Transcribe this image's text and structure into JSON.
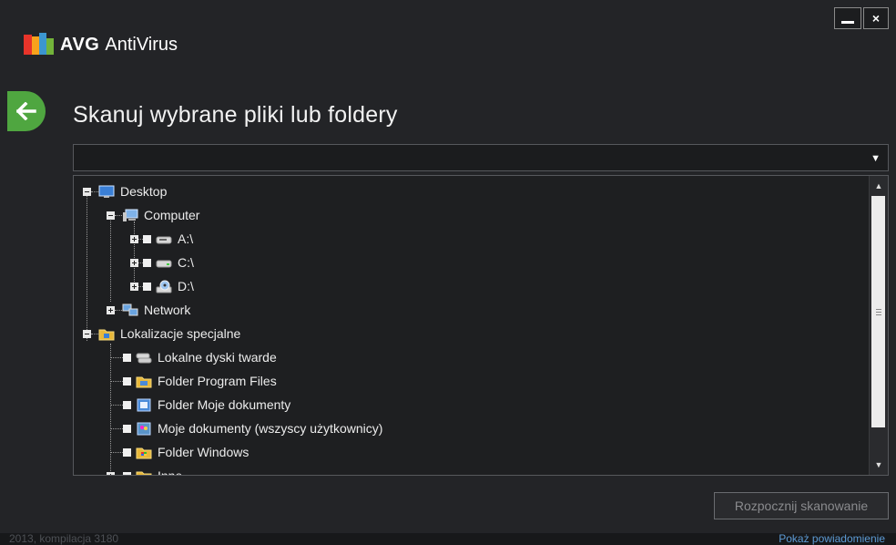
{
  "window": {
    "minimize_label": "—",
    "close_label": "×"
  },
  "app": {
    "brand": "AVG",
    "product": "AntiVirus"
  },
  "page": {
    "title": "Skanuj wybrane pliki lub foldery"
  },
  "dropdown": {
    "value": "",
    "arrow": "▼"
  },
  "tree": {
    "desktop": "Desktop",
    "computer": "Computer",
    "drive_a": "A:\\",
    "drive_c": "C:\\",
    "drive_d": "D:\\",
    "network": "Network",
    "special": "Lokalizacje specjalne",
    "local_disks": "Lokalne dyski twarde",
    "program_files": "Folder Program Files",
    "my_documents": "Folder Moje dokumenty",
    "all_users_docs": "Moje dokumenty (wszyscy użytkownicy)",
    "windows_folder": "Folder Windows",
    "other": "Inne"
  },
  "actions": {
    "start_scan": "Rozpocznij skanowanie"
  },
  "footer": {
    "version": "2013, kompilacja 3180",
    "notifications": "Pokaż powiadomienie"
  },
  "colors": {
    "background": "#232427",
    "accent_green": "#4fa640",
    "link_blue": "#5d9bd5"
  }
}
